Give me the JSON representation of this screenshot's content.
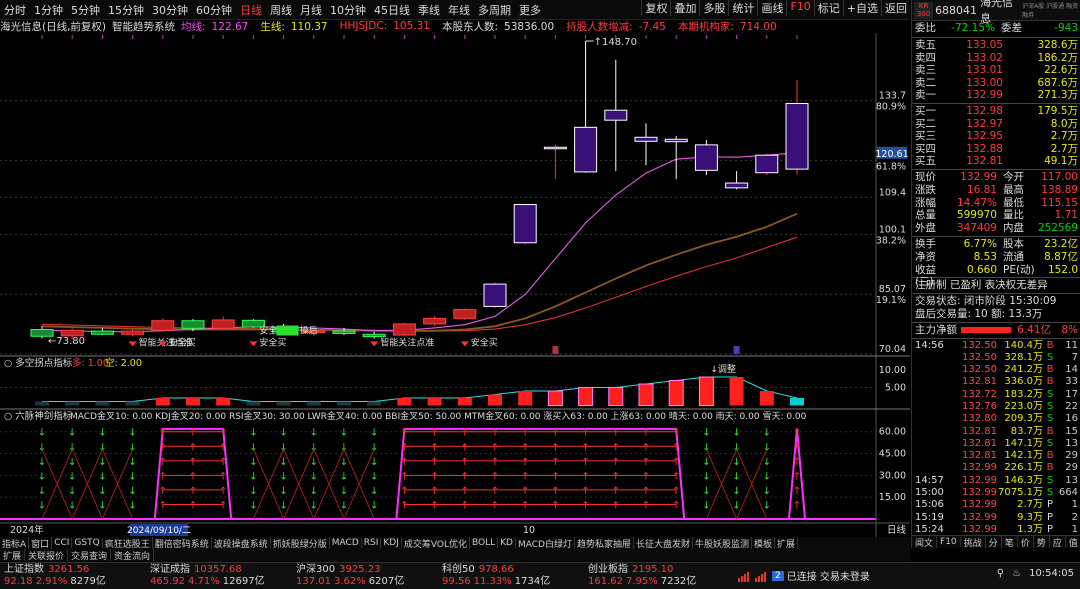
{
  "timeframes": [
    "分时",
    "1分钟",
    "5分钟",
    "15分钟",
    "30分钟",
    "60分钟",
    "日线",
    "周线",
    "月线",
    "10分钟",
    "45日线",
    "季线",
    "年线",
    "多周期",
    "更多"
  ],
  "active_timeframe": "日线",
  "top_right": [
    "复权",
    "叠加",
    "多股",
    "统计",
    "画线",
    "F10",
    "标记",
    "+自选",
    "返回"
  ],
  "stock_code": "688041",
  "stock_name": "海光信息",
  "exchange_badge_top": "KR",
  "exchange_badge_bottom": "300",
  "tabs_right_small": "沪深A股 沪股通 融资融券",
  "info": {
    "title": "海光信息(日线,前复权)",
    "indicator": "智能趋势系统",
    "ma1_label": "均线:",
    "ma1": "122.67",
    "ma2_label": "生线:",
    "ma2": "110.37",
    "ma3_label": "HHJSJDC:",
    "ma3": "105.31",
    "holders_label": "本股东人数:",
    "holders": "53836.00",
    "holder_change_label": "持股人数增减:",
    "holder_change": "-7.45",
    "inst_label": "本期机构家:",
    "inst": "714.00"
  },
  "price_axis": {
    "labels": [
      {
        "v": "133.7",
        "pct": "80.9%"
      },
      {
        "v": "118.7",
        "pct": "61.8%"
      },
      {
        "v": "109.4",
        "pct": ""
      },
      {
        "v": "100.1",
        "pct": "38.2%"
      },
      {
        "v": "85.07",
        "pct": "19.1%"
      },
      {
        "v": "70.04",
        "pct": ""
      }
    ],
    "current": "120.61"
  },
  "chart_annotations": {
    "high": "148.70",
    "low": "73.80",
    "buy1": "智能关注点准",
    "buy2": "安全买",
    "buy3": "安全买",
    "buy4": "安全买",
    "buy5": "智能关注点准",
    "buy6": "操后",
    "buy7": "安全买"
  },
  "sub1": {
    "title": "多空拐点指标",
    "a_label": "多:",
    "a": "1.00",
    "b_label": "空:",
    "b": "2.00",
    "axis": [
      "10.00",
      "5.00"
    ],
    "note": "调整"
  },
  "sub2": {
    "title": "六脉神剑指标",
    "items": "MACD金叉10: 0.00  KDJ金叉20: 0.00  RSI金叉30: 30.00  LWR金叉40: 0.00  BBI金叉50: 50.00  MTM金叉60: 0.00  涨买入63: 0.00  上涨63: 0.00  晴天: 0.00  雨天: 0.00  雪天: 0.00",
    "axis": [
      "60.00",
      "45.00",
      "30.00",
      "15.00"
    ]
  },
  "date_axis": {
    "left": "2024年",
    "cursor": "2024/09/10/二",
    "mid": "10",
    "right": "日线"
  },
  "bottom_tabs1": [
    "指标A",
    "窗口",
    "CCI",
    "GSTQ",
    "疯狂选股王",
    "翻倍密码系统",
    "波段操盘系统",
    "抓妖股绿分版",
    "MACD",
    "RSI",
    "KDJ",
    "成交筹VOL优化",
    "BOLL",
    "KD",
    "MACD白绿灯",
    "趋势私家抽屉",
    "长征大盘发财",
    "牛股妖股监测",
    "模板",
    "扩展"
  ],
  "bottom_tabs2": [
    "扩展",
    "关联报价",
    "交易查询",
    "资金流向"
  ],
  "right": {
    "webi_label": "委比",
    "webi": "-72.15%",
    "wecha_label": "委差",
    "wecha": "-943",
    "sells": [
      {
        "l": "卖五",
        "p": "133.05",
        "v": "328.6万"
      },
      {
        "l": "卖四",
        "p": "133.02",
        "v": "186.2万"
      },
      {
        "l": "卖三",
        "p": "133.01",
        "v": "22.6万"
      },
      {
        "l": "卖二",
        "p": "133.00",
        "v": "687.6万"
      },
      {
        "l": "卖一",
        "p": "132.99",
        "v": "271.3万"
      }
    ],
    "buys": [
      {
        "l": "买一",
        "p": "132.98",
        "v": "179.5万"
      },
      {
        "l": "买二",
        "p": "132.97",
        "v": "8.0万"
      },
      {
        "l": "买三",
        "p": "132.95",
        "v": "2.7万"
      },
      {
        "l": "买四",
        "p": "132.88",
        "v": "2.7万"
      },
      {
        "l": "买五",
        "p": "132.81",
        "v": "49.1万"
      }
    ],
    "quote": [
      {
        "l": "现价",
        "a": "132.99",
        "l2": "今开",
        "b": "117.00"
      },
      {
        "l": "涨跌",
        "a": "16.81",
        "l2": "最高",
        "b": "138.89"
      },
      {
        "l": "涨幅",
        "a": "14.47%",
        "l2": "最低",
        "b": "115.15"
      },
      {
        "l": "总量",
        "a": "599970",
        "l2": "量比",
        "b": "1.71"
      },
      {
        "l": "外盘",
        "a": "347409",
        "l2": "内盘",
        "b": "252569"
      }
    ],
    "quote2": [
      {
        "l": "换手",
        "a": "6.77%",
        "l2": "股本",
        "b": "23.2亿"
      },
      {
        "l": "净资",
        "a": "8.53",
        "l2": "流通",
        "b": "8.87亿"
      },
      {
        "l": "收益(三)",
        "a": "0.660",
        "l2": "PE(动)",
        "b": "152.0"
      }
    ],
    "reg": "注册制 已盈利 表决权无差异",
    "trade_state": "交易状态: 闭市阶段 15:30:09",
    "after": "盘后交易量: 10  额: 13.3万",
    "mainflow_label": "主力净额",
    "mainflow": "6.41亿",
    "mainflow_pct": "8%",
    "ticks": [
      {
        "t": "14:56",
        "p": "132.50",
        "v": "140.4万",
        "d": "B",
        "n": "11"
      },
      {
        "t": "",
        "p": "132.50",
        "v": "328.1万",
        "d": "S",
        "n": "7"
      },
      {
        "t": "",
        "p": "132.50",
        "v": "241.2万",
        "d": "B",
        "n": "14"
      },
      {
        "t": "",
        "p": "132.81",
        "v": "336.0万",
        "d": "B",
        "n": "33"
      },
      {
        "t": "",
        "p": "132.72",
        "v": "183.2万",
        "d": "S",
        "n": "17"
      },
      {
        "t": "",
        "p": "132.76",
        "v": "223.0万",
        "d": "S",
        "n": "22"
      },
      {
        "t": "",
        "p": "132.80",
        "v": "209.3万",
        "d": "S",
        "n": "16"
      },
      {
        "t": "",
        "p": "132.81",
        "v": "83.7万",
        "d": "B",
        "n": "15"
      },
      {
        "t": "",
        "p": "132.81",
        "v": "147.1万",
        "d": "S",
        "n": "13"
      },
      {
        "t": "",
        "p": "132.81",
        "v": "142.1万",
        "d": "B",
        "n": "29"
      },
      {
        "t": "",
        "p": "132.99",
        "v": "226.1万",
        "d": "B",
        "n": "29"
      },
      {
        "t": "14:57",
        "p": "132.99",
        "v": "146.3万",
        "d": "S",
        "n": "13"
      },
      {
        "t": "15:00",
        "p": "132.99",
        "v": "7075.1万",
        "d": "S",
        "n": "664"
      },
      {
        "t": "15:06",
        "p": "132.99",
        "v": "2.7万",
        "d": "P",
        "n": "1"
      },
      {
        "t": "15:19",
        "p": "132.99",
        "v": "9.3万",
        "d": "P",
        "n": "2"
      },
      {
        "t": "15:24",
        "p": "132.99",
        "v": "1.3万",
        "d": "P",
        "n": "1"
      }
    ],
    "bottom_tabs": [
      "闻文",
      "F10",
      "挑战",
      "分",
      "笔",
      "价",
      "势",
      "应",
      "值",
      "更"
    ]
  },
  "status": {
    "indices": [
      {
        "name": "上证指数",
        "val": "3261.56",
        "chg": "92.18",
        "pct": "2.91%",
        "amt": "8279亿"
      },
      {
        "name": "深证成指",
        "val": "10357.68",
        "chg": "465.92",
        "pct": "4.71%",
        "amt": "12697亿"
      },
      {
        "name": "沪深300",
        "val": "3925.23",
        "chg": "137.01",
        "pct": "3.62%",
        "amt": "6207亿"
      },
      {
        "name": "科创50",
        "val": "978.66",
        "chg": "99.56",
        "pct": "11.33%",
        "amt": "1734亿"
      },
      {
        "name": "创业板指",
        "val": "2195.10",
        "chg": "161.62",
        "pct": "7.95%",
        "amt": "7232亿"
      }
    ],
    "conn": "已连接 交易未登录",
    "conn_badge": "2",
    "time": "10:54:05"
  },
  "chart_data": {
    "type": "candlestick",
    "candles": [
      {
        "o": 76.2,
        "h": 77.0,
        "l": 74.0,
        "c": 74.5
      },
      {
        "o": 74.6,
        "h": 76.5,
        "l": 73.8,
        "c": 76.0
      },
      {
        "o": 75.8,
        "h": 76.6,
        "l": 74.8,
        "c": 75.0
      },
      {
        "o": 75.0,
        "h": 76.2,
        "l": 74.5,
        "c": 75.8
      },
      {
        "o": 76.0,
        "h": 79.0,
        "l": 75.6,
        "c": 78.4
      },
      {
        "o": 78.4,
        "h": 78.8,
        "l": 75.8,
        "c": 76.5
      },
      {
        "o": 76.5,
        "h": 79.5,
        "l": 76.0,
        "c": 78.6
      },
      {
        "o": 78.5,
        "h": 78.8,
        "l": 76.6,
        "c": 76.8
      },
      {
        "o": 76.8,
        "h": 77.6,
        "l": 75.0,
        "c": 75.6
      },
      {
        "o": 75.4,
        "h": 76.4,
        "l": 74.6,
        "c": 75.8
      },
      {
        "o": 75.8,
        "h": 76.6,
        "l": 74.8,
        "c": 75.2
      },
      {
        "o": 75.0,
        "h": 75.6,
        "l": 73.9,
        "c": 74.4
      },
      {
        "o": 74.8,
        "h": 77.9,
        "l": 74.6,
        "c": 77.6
      },
      {
        "o": 77.6,
        "h": 79.6,
        "l": 77.0,
        "c": 79.0
      },
      {
        "o": 79.0,
        "h": 81.5,
        "l": 78.6,
        "c": 81.2
      },
      {
        "o": 82.0,
        "h": 88.0,
        "l": 81.6,
        "c": 87.6
      },
      {
        "o": 98.0,
        "h": 107.8,
        "l": 97.6,
        "c": 107.6
      },
      {
        "o": 122.0,
        "h": 122.6,
        "l": 114.0,
        "c": 122.0
      },
      {
        "o": 127.0,
        "h": 148.7,
        "l": 115.6,
        "c": 115.8
      },
      {
        "o": 131.3,
        "h": 144.0,
        "l": 116.0,
        "c": 128.8
      },
      {
        "o": 124.5,
        "h": 128.0,
        "l": 117.5,
        "c": 123.5
      },
      {
        "o": 124.0,
        "h": 124.8,
        "l": 114.0,
        "c": 123.4
      },
      {
        "o": 122.6,
        "h": 123.8,
        "l": 115.0,
        "c": 116.2
      },
      {
        "o": 113.0,
        "h": 116.0,
        "l": 111.4,
        "c": 111.8
      },
      {
        "o": 115.6,
        "h": 120.4,
        "l": 115.0,
        "c": 120.0
      },
      {
        "o": 116.5,
        "h": 138.89,
        "l": 115.15,
        "c": 132.99
      }
    ],
    "ylim": [
      70.04,
      148.7
    ],
    "ma_short": [
      76.0,
      75.8,
      75.7,
      75.6,
      75.9,
      76.2,
      76.6,
      76.9,
      76.8,
      76.6,
      76.3,
      75.9,
      76.0,
      76.6,
      77.4,
      79.5,
      85.0,
      94.0,
      103.0,
      110.0,
      115.5,
      119.0,
      119.6,
      119.5,
      120.0,
      120.6
    ],
    "ma_mid": [
      77.0,
      76.8,
      76.6,
      76.4,
      76.3,
      76.2,
      76.2,
      76.2,
      76.2,
      76.1,
      76.0,
      75.9,
      75.8,
      75.9,
      76.2,
      77.0,
      79.0,
      82.0,
      85.5,
      89.0,
      92.3,
      95.0,
      97.5,
      99.5,
      102.0,
      105.3
    ],
    "ma_long": [
      77.5,
      77.3,
      77.1,
      76.9,
      76.7,
      76.6,
      76.5,
      76.4,
      76.3,
      76.2,
      76.1,
      76.0,
      75.9,
      75.8,
      75.9,
      76.3,
      77.4,
      79.2,
      81.6,
      84.3,
      87.0,
      89.6,
      92.0,
      94.2,
      96.8,
      99.4
    ],
    "sub1_values": [
      1,
      1,
      1,
      1,
      2,
      2,
      2,
      1,
      1,
      1,
      1,
      1,
      2,
      2,
      2,
      3,
      4,
      4,
      5,
      5,
      6,
      7,
      8,
      8,
      4,
      2
    ],
    "sub1_signals": [
      0,
      0,
      0,
      0,
      1,
      1,
      1,
      0,
      0,
      0,
      0,
      0,
      1,
      1,
      1,
      1,
      1,
      1,
      1,
      1,
      1,
      1,
      1,
      1,
      1,
      -1
    ]
  }
}
